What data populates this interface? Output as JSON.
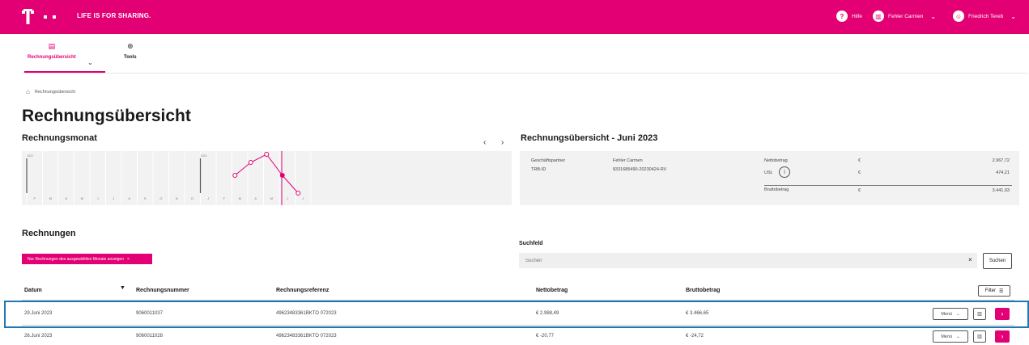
{
  "brand": {
    "tagline": "LIFE IS FOR SHARING.",
    "color": "#e20074"
  },
  "header": {
    "help": {
      "icon": "help-icon",
      "label": "Hilfe"
    },
    "company": {
      "icon": "company-icon",
      "label": "Fehler Carmen"
    },
    "user": {
      "icon": "user-icon",
      "label": "Friedrich Tereb"
    }
  },
  "nav": {
    "tabs": [
      {
        "label": "Rechnungsübersicht",
        "icon": "invoice-icon"
      },
      {
        "label": "Tools",
        "icon": "plus-circle-icon"
      }
    ]
  },
  "breadcrumb": {
    "label": "Rechnungsübersicht"
  },
  "page_title": "Rechnungsübersicht",
  "month_section": {
    "title": "Rechnungsmonat"
  },
  "chart_data": {
    "type": "line",
    "x": [
      "F",
      "M",
      "A",
      "M",
      "J",
      "J",
      "A",
      "S",
      "O",
      "N",
      "D",
      "J",
      "F",
      "M",
      "A",
      "M",
      "J",
      "J"
    ],
    "year_labels": [
      "2022",
      "2023"
    ],
    "selected_index": 16
  },
  "summary": {
    "title": "Rechnungsübersicht - Juni 2023",
    "partner_label": "Geschäftspartner",
    "partner_value": "Fehler Carmen",
    "trb_label": "TRB-ID",
    "trb_value": "8331685490-20230424-RV",
    "netto_label": "Nettobetrag",
    "ust_label": "USt.",
    "brutto_label": "Bruttobetrag",
    "currency": "€",
    "netto_value": "2.967,72",
    "ust_value": "474,21",
    "brutto_value": "3.441,93"
  },
  "invoices": {
    "title": "Rechnungen",
    "filter_chip": "Nur Rechnungen des ausgewählten Monats anzeigen",
    "search_label": "Suchfeld",
    "search_placeholder": "Suchen",
    "search_button": "Suchen",
    "filter_button": "Filter",
    "columns": {
      "datum": "Datum",
      "nummer": "Rechnungsnummer",
      "referenz": "Rechnungsreferenz",
      "netto": "Nettobetrag",
      "brutto": "Bruttobetrag"
    },
    "menu_label": "Menü",
    "rows": [
      {
        "datum": "29.Juni 2023",
        "nummer": "9060011037",
        "referenz": "49623483361BKTO 072023",
        "netto": "€ 2.988,49",
        "brutto": "€ 3.466,65"
      },
      {
        "datum": "26.Juni 2023",
        "nummer": "9060011028",
        "referenz": "49623483361BKTO 072023",
        "netto": "€ -20,77",
        "brutto": "€ -24,72"
      }
    ]
  }
}
